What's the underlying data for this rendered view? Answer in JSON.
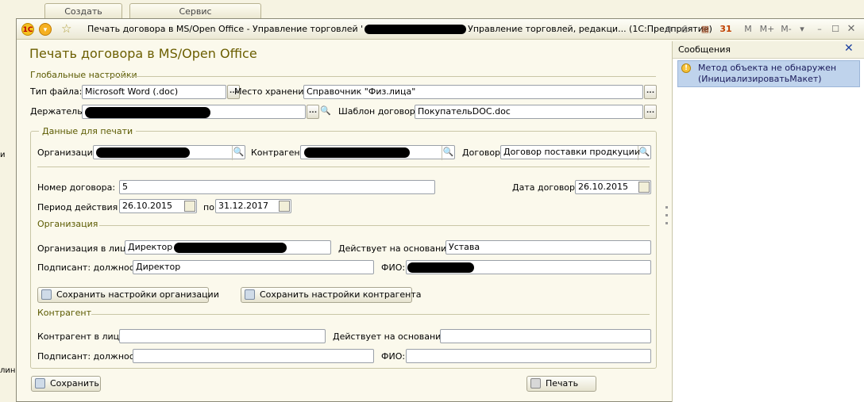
{
  "background_tabs": [
    "Создать",
    "Сервис"
  ],
  "window": {
    "title_left": "Печать договора в MS/Open Office - Управление торговлей '",
    "title_right": "Управление торговлей, редакци... (1С:Предприятие)",
    "buttons": [
      "M",
      "M+",
      "M-"
    ]
  },
  "form": {
    "title": "Печать договора в MS/Open Office",
    "global_section": "Глобальные настройки",
    "file_type_label": "Тип файла:",
    "file_type_value": "Microsoft Word (.doc)",
    "storage_label": "Место хранения:",
    "storage_value": "Справочник \"Физ.лица\"",
    "holder_label": "Держатель:",
    "holder_value": "",
    "template_label": "Шаблон договора:",
    "template_value": "ПокупательDOC.doc",
    "print_data_section": "Данные для печати",
    "organization_label": "Организация:",
    "counterparty_label": "Контрагент:",
    "contract_label": "Договор:",
    "contract_value": "Договор поставки продкуции",
    "contract_number_label": "Номер договора:",
    "contract_number_value": "5",
    "contract_date_label": "Дата договора:",
    "contract_date_value": "26.10.2015",
    "period_label": "Период действия с:",
    "period_from_value": "26.10.2015",
    "period_to_label": "по:",
    "period_to_value": "31.12.2017",
    "org_section": "Организация",
    "org_person_label": "Организация в лице:",
    "org_person_value": "Директор",
    "org_basis_label": "Действует на основании:",
    "org_basis_value": "Устава",
    "org_signer_label": "Подписант: должность:",
    "org_signer_value": "Директор",
    "org_fio_label": "ФИО:",
    "save_org_button": "Сохранить настройки организации",
    "save_cp_button": "Сохранить настройки контрагента",
    "cp_section": "Контрагент",
    "cp_person_label": "Контрагент в лице:",
    "cp_basis_label": "Действует на основании:",
    "cp_signer_label": "Подписант: должность:",
    "cp_fio_label": "ФИО:",
    "save_button": "Сохранить",
    "print_button": "Печать"
  },
  "messages": {
    "header": "Сообщения",
    "items": [
      {
        "line1": "Метод объекта не обнаружен",
        "line2": "(ИнициализироватьМакет)"
      }
    ]
  },
  "left_fragments": [
    "и",
    "лин"
  ]
}
